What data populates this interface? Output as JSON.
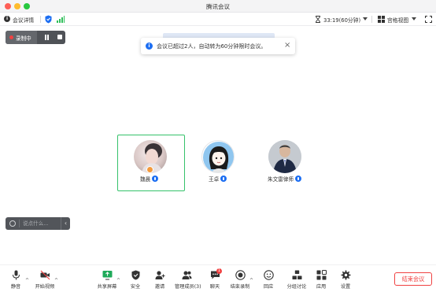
{
  "window": {
    "title": "腾讯会议"
  },
  "infobar": {
    "meeting_info_label": "会议详情",
    "timer": "33:19(60分钟)",
    "view_label": "宫格视图"
  },
  "recording": {
    "label": "录制中"
  },
  "notice": {
    "text": "会议已超过2人，自动转为60分钟限时会议。"
  },
  "participants": [
    {
      "name": "魏晨",
      "muted": false,
      "active": true,
      "host": true
    },
    {
      "name": "王卓",
      "muted": false,
      "active": false,
      "host": false
    },
    {
      "name": "朱文雷律师",
      "muted": false,
      "active": false,
      "host": false
    }
  ],
  "chat": {
    "placeholder": "说点什么..."
  },
  "toolbar": {
    "mute": "静音",
    "video": "开始视频",
    "share": "共享屏幕",
    "security": "安全",
    "invite": "邀请",
    "members": "管理成员(3)",
    "chat": "聊天",
    "chat_badge": "1",
    "record": "结束录制",
    "reactions": "回应",
    "breakout": "分组讨论",
    "apps": "应用",
    "settings": "设置",
    "end_meeting": "结束会议"
  },
  "colors": {
    "accent": "#1c6ef2",
    "active_speaker": "#35c26a",
    "danger": "#f04141",
    "signal": "#2fbf5a"
  }
}
